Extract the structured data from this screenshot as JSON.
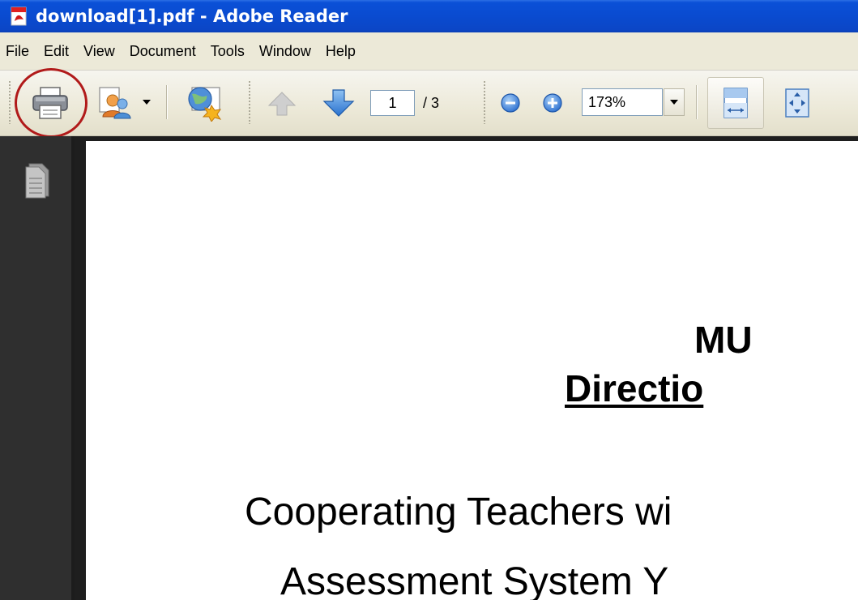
{
  "window": {
    "title": "download[1].pdf - Adobe Reader"
  },
  "menubar": {
    "items": [
      "File",
      "Edit",
      "View",
      "Document",
      "Tools",
      "Window",
      "Help"
    ]
  },
  "toolbar": {
    "current_page": "1",
    "page_total": "/ 3",
    "zoom": "173%"
  },
  "document": {
    "heading_line1": "MU",
    "heading_line2": "Directio",
    "body_line1": "Cooperating Teachers wi",
    "body_line2": "Assessment System   Y"
  },
  "icons": {
    "app": "pdf-app-icon",
    "print": "printer-icon",
    "collaborate": "people-icon",
    "web": "globe-icon",
    "prev": "arrow-up-icon",
    "next": "arrow-down-icon",
    "zoom_out": "minus-circle-icon",
    "zoom_in": "plus-circle-icon",
    "fit_width": "fit-width-icon",
    "fit_page": "fit-page-icon",
    "pages": "pages-icon"
  },
  "colors": {
    "titlebar": "#0a4bd0",
    "highlight": "#b11a1a",
    "sidepanel": "#2f2f2f"
  }
}
